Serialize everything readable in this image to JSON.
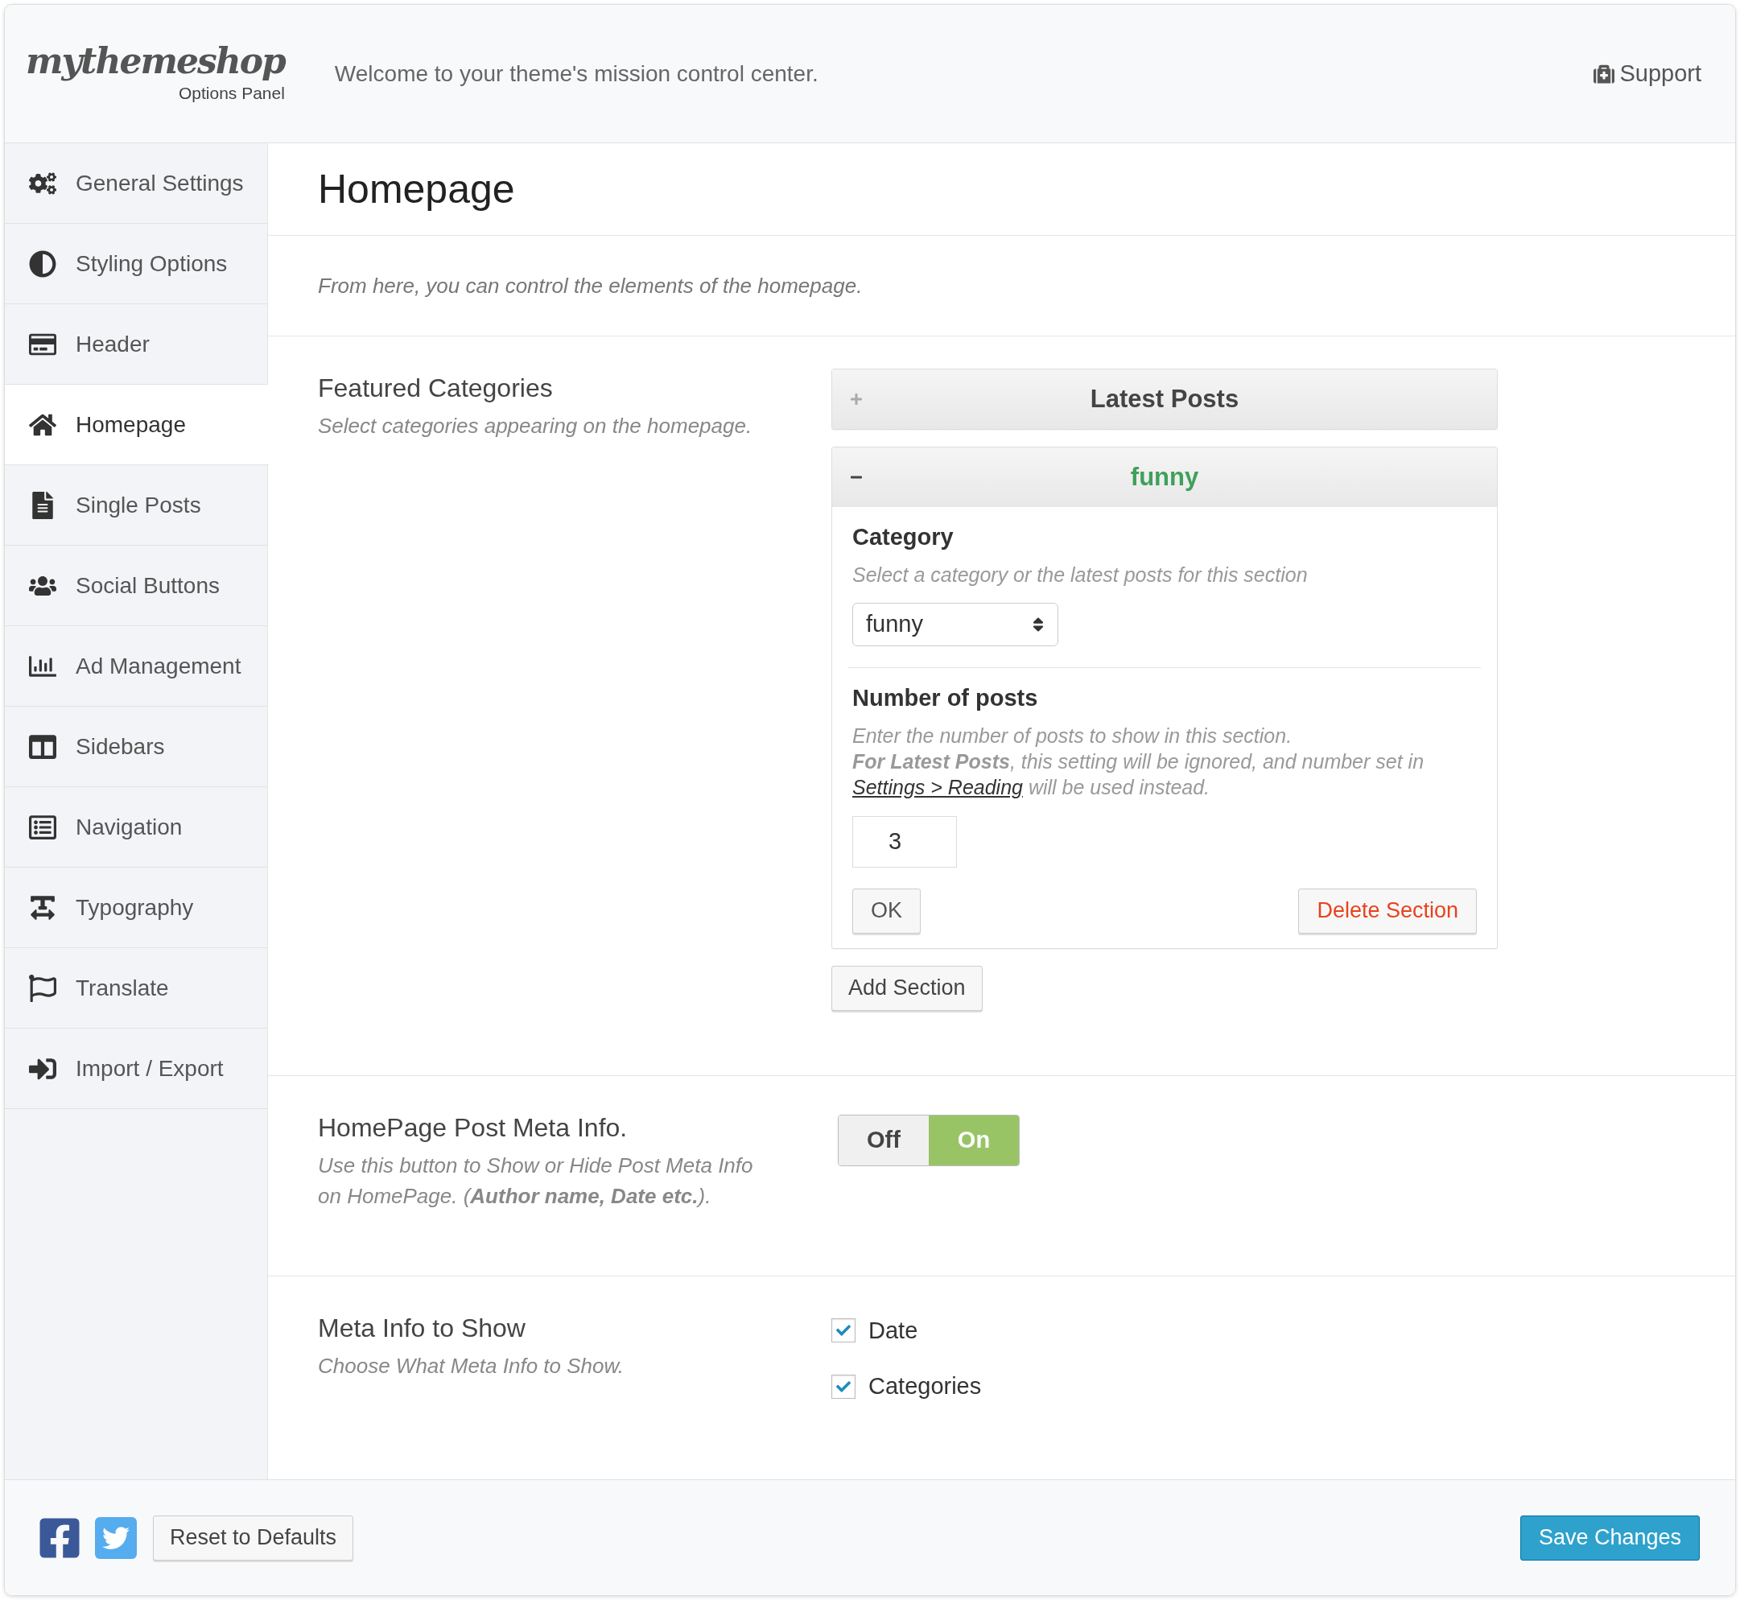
{
  "header": {
    "logo": "mythemeshop",
    "logo_subtitle": "Options Panel",
    "tagline": "Welcome to your theme's mission control center.",
    "support_link": "Support"
  },
  "sidebar": {
    "items": [
      {
        "label": "General Settings",
        "selected": false
      },
      {
        "label": "Styling Options",
        "selected": false
      },
      {
        "label": "Header",
        "selected": false
      },
      {
        "label": "Homepage",
        "selected": true
      },
      {
        "label": "Single Posts",
        "selected": false
      },
      {
        "label": "Social Buttons",
        "selected": false
      },
      {
        "label": "Ad Management",
        "selected": false
      },
      {
        "label": "Sidebars",
        "selected": false
      },
      {
        "label": "Navigation",
        "selected": false
      },
      {
        "label": "Typography",
        "selected": false
      },
      {
        "label": "Translate",
        "selected": false
      },
      {
        "label": "Import / Export",
        "selected": false
      }
    ]
  },
  "page": {
    "title": "Homepage",
    "description": "From here, you can control the elements of the homepage."
  },
  "featured_categories": {
    "label": "Featured Categories",
    "description": "Select categories appearing on the homepage.",
    "sections": [
      {
        "title": "Latest Posts",
        "expanded": false
      },
      {
        "title": "funny",
        "expanded": true,
        "category_label": "Category",
        "category_hint": "Select a category or the latest posts for this section",
        "category_value": "funny",
        "number_label": "Number of posts",
        "number_hint": "Enter the number of posts to show in this section.",
        "number_note": "**For Latest Posts**, this setting will be ignored, and number set in",
        "number_link": "Settings > Reading",
        "number_note_end": "will be used instead.",
        "number_value": "3",
        "ok_button": "OK",
        "delete_button": "Delete Section"
      }
    ],
    "add_button": "Add Section"
  },
  "post_meta": {
    "label": "HomePage Post Meta Info.",
    "description": "Use this button to Show or Hide Post Meta Info on HomePage. (**Author name, Date etc.**).",
    "off_label": "Off",
    "on_label": "On",
    "on": true
  },
  "meta_info": {
    "label": "Meta Info to Show",
    "description": "Choose What Meta Info to Show.",
    "options": [
      {
        "label": "Date",
        "checked": true
      },
      {
        "label": "Categories",
        "checked": true
      }
    ]
  },
  "footer": {
    "reset_button": "Reset to Defaults",
    "save_button": "Save Changes"
  }
}
